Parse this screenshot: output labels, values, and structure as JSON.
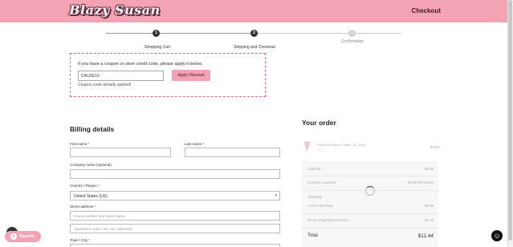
{
  "header": {
    "logo": "Blazy Susan",
    "checkout_link": "Checkout",
    "bg_color": "#f4a3b5"
  },
  "steps": [
    {
      "number": "1",
      "label": "Shopping Cart",
      "state": "done"
    },
    {
      "number": "2",
      "label": "Shipping and Checkout",
      "state": "done"
    },
    {
      "number": "3",
      "label": "Confirmation",
      "state": "todo"
    }
  ],
  "coupon": {
    "prompt": "If you have a coupon or store credit code, please apply it below.",
    "input_value": "CAUSE10",
    "apply_label": "Apply Discount",
    "message": "Coupon code already applied!"
  },
  "billing": {
    "title": "Billing details",
    "first_name_label": "First name",
    "last_name_label": "Last name",
    "company_label": "Company name (optional)",
    "country_label": "Country / Region",
    "country_value": "United States (US)",
    "street_label": "Street address",
    "street_placeholder": "House number and street name",
    "apartment_placeholder": "Apartment, suite, unit, etc. (optional)",
    "town_label": "Town / City",
    "required_mark": "*"
  },
  "order": {
    "title": "Your order",
    "item_name": "Pink Pre Rolled Cones – 6 Count",
    "item_qty": "× 1",
    "item_price": "$4.99",
    "subtotal_label": "Subtotal",
    "subtotal_value": "$4.99",
    "coupon_label": "Coupon: cause10",
    "coupon_value": "-$0.50 [Remove]",
    "shipping_label": "Shipping",
    "shipping_method": "USA Flat Rate:",
    "shipping_value": "$5.06",
    "protection_label": "Route Shipping Protection",
    "protection_value": "$1.49",
    "total_label": "Total",
    "total_value": "$11.44"
  },
  "support": {
    "label": "Soporte"
  }
}
